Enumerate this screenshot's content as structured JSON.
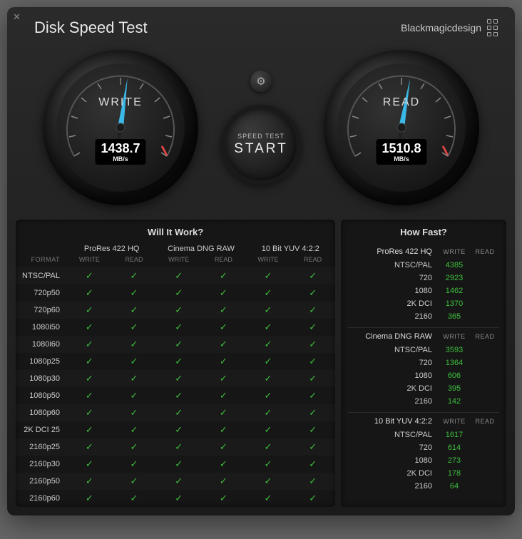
{
  "title": "Disk Speed Test",
  "brand": "Blackmagicdesign",
  "gauges": {
    "write": {
      "label": "WRITE",
      "value": "1438.7",
      "unit": "MB/s"
    },
    "read": {
      "label": "READ",
      "value": "1510.8",
      "unit": "MB/s"
    }
  },
  "start": {
    "label": "SPEED TEST",
    "main": "START"
  },
  "wiw": {
    "title": "Will It Work?",
    "format_label": "FORMAT",
    "wr_labels": {
      "write": "WRITE",
      "read": "READ"
    },
    "codecs": [
      "ProRes 422 HQ",
      "Cinema DNG RAW",
      "10 Bit YUV 4:2:2"
    ],
    "formats": [
      "NTSC/PAL",
      "720p50",
      "720p60",
      "1080i50",
      "1080i60",
      "1080p25",
      "1080p30",
      "1080p50",
      "1080p60",
      "2K DCI 25",
      "2160p25",
      "2160p30",
      "2160p50",
      "2160p60"
    ]
  },
  "hf": {
    "title": "How Fast?",
    "wr_labels": {
      "write": "WRITE",
      "read": "READ"
    },
    "groups": [
      {
        "name": "ProRes 422 HQ",
        "rows": [
          {
            "res": "NTSC/PAL",
            "write": "4385",
            "read": ""
          },
          {
            "res": "720",
            "write": "2923",
            "read": ""
          },
          {
            "res": "1080",
            "write": "1462",
            "read": ""
          },
          {
            "res": "2K DCI",
            "write": "1370",
            "read": ""
          },
          {
            "res": "2160",
            "write": "365",
            "read": ""
          }
        ]
      },
      {
        "name": "Cinema DNG RAW",
        "rows": [
          {
            "res": "NTSC/PAL",
            "write": "3593",
            "read": ""
          },
          {
            "res": "720",
            "write": "1364",
            "read": ""
          },
          {
            "res": "1080",
            "write": "606",
            "read": ""
          },
          {
            "res": "2K DCI",
            "write": "395",
            "read": ""
          },
          {
            "res": "2160",
            "write": "142",
            "read": ""
          }
        ]
      },
      {
        "name": "10 Bit YUV 4:2:2",
        "rows": [
          {
            "res": "NTSC/PAL",
            "write": "1617",
            "read": ""
          },
          {
            "res": "720",
            "write": "614",
            "read": ""
          },
          {
            "res": "1080",
            "write": "273",
            "read": ""
          },
          {
            "res": "2K DCI",
            "write": "178",
            "read": ""
          },
          {
            "res": "2160",
            "write": "64",
            "read": ""
          }
        ]
      }
    ]
  }
}
